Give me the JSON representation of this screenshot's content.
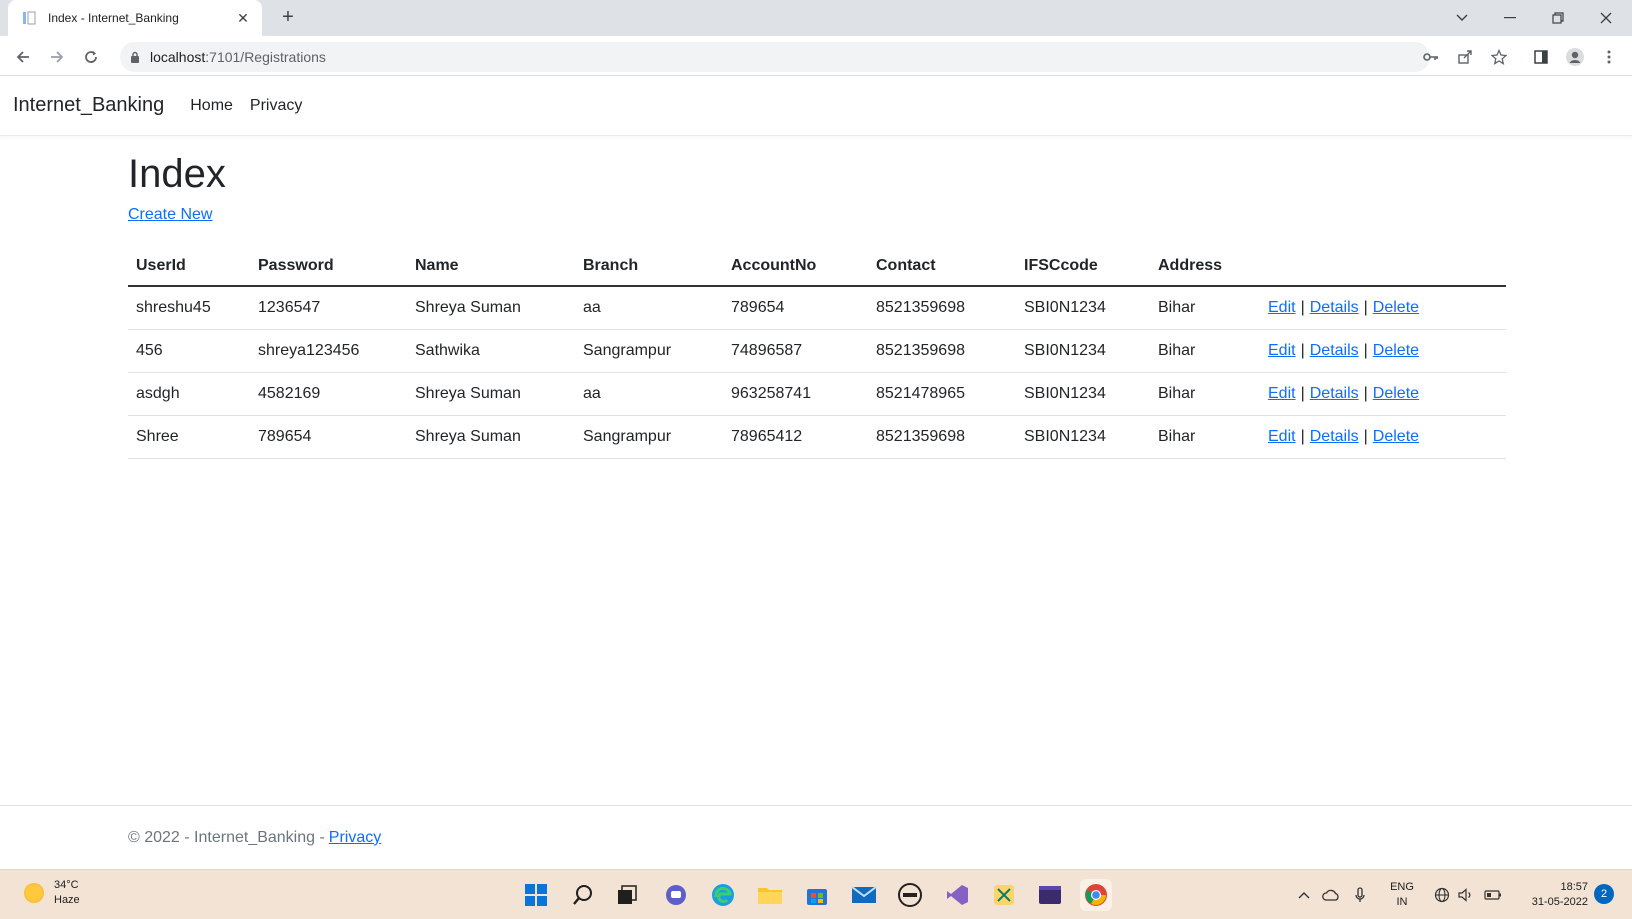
{
  "browser": {
    "tab_title": "Index - Internet_Banking",
    "new_tab_label": "+",
    "url_host": "localhost",
    "url_path": ":7101/Registrations"
  },
  "navbar": {
    "brand": "Internet_Banking",
    "links": [
      "Home",
      "Privacy"
    ]
  },
  "page": {
    "title": "Index",
    "create_new": "Create New"
  },
  "table": {
    "headers": [
      "UserId",
      "Password",
      "Name",
      "Branch",
      "AccountNo",
      "Contact",
      "IFSCcode",
      "Address"
    ],
    "rows": [
      [
        "shreshu45",
        "1236547",
        "Shreya Suman",
        "aa",
        "789654",
        "8521359698",
        "SBI0N1234",
        "Bihar"
      ],
      [
        "456",
        "shreya123456",
        "Sathwika",
        "Sangrampur",
        "74896587",
        "8521359698",
        "SBI0N1234",
        "Bihar"
      ],
      [
        "asdgh",
        "4582169",
        "Shreya Suman",
        "aa",
        "963258741",
        "8521478965",
        "SBI0N1234",
        "Bihar"
      ],
      [
        "Shree",
        "789654",
        "Shreya Suman",
        "Sangrampur",
        "78965412",
        "8521359698",
        "SBI0N1234",
        "Bihar"
      ]
    ],
    "actions": [
      "Edit",
      "Details",
      "Delete"
    ],
    "separator": "|"
  },
  "footer": {
    "text": "© 2022 - Internet_Banking -",
    "privacy": "Privacy"
  },
  "taskbar": {
    "temperature": "34°C",
    "condition": "Haze",
    "lang_top": "ENG",
    "lang_bottom": "IN",
    "time": "18:57",
    "date": "31-05-2022",
    "notification_count": "2"
  },
  "colors": {
    "link": "#0d6efd",
    "taskbar": "#f3e3d4",
    "tabbar": "#dee1e6"
  }
}
